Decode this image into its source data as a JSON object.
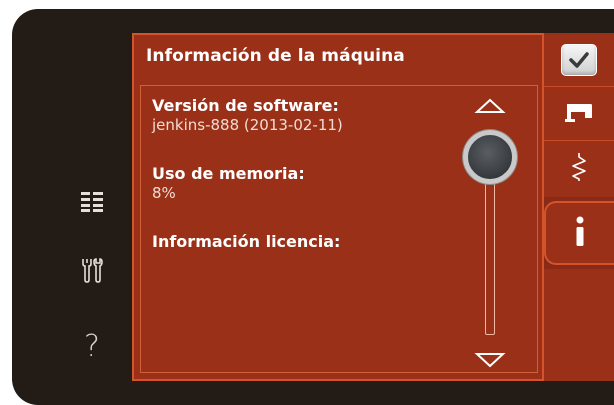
{
  "panel": {
    "title": "Información de la máquina",
    "fields": [
      {
        "label": "Versión de software:",
        "value": "jenkins-888 (2013-02-11)"
      },
      {
        "label": "Uso de memoria:",
        "value": "8%"
      },
      {
        "label": "Información licencia:",
        "value": ""
      }
    ]
  },
  "left_nav": {
    "help_label": "?",
    "icons": [
      "list-icon",
      "tools-icon",
      "help-icon"
    ]
  },
  "right_tabs": {
    "icons": [
      "checkbox-icon",
      "sewing-machine-icon",
      "zigzag-stitch-icon",
      "info-icon"
    ],
    "active": "info"
  },
  "scrollbar": {
    "position": 0.0
  },
  "colors": {
    "background": "#231b16",
    "panel": "#9b3019",
    "panel_border": "#d5532a",
    "text": "#ffffff"
  }
}
